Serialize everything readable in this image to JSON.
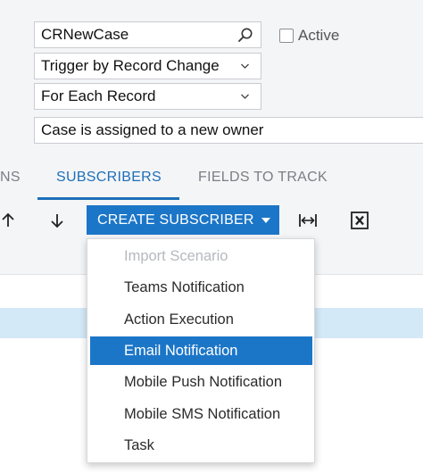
{
  "form": {
    "name_value": "CRNewCase",
    "trigger_value": "Trigger by Record Change",
    "each_value": "For Each Record",
    "description_value": "Case is assigned to a new owner",
    "active_label": "Active",
    "active_checked": false
  },
  "tabs": {
    "partial": "NS",
    "subscribers": "SUBSCRIBERS",
    "fields": "FIELDS TO TRACK"
  },
  "toolbar": {
    "create_label": "CREATE SUBSCRIBER"
  },
  "menu": {
    "items": [
      {
        "label": "Import Scenario",
        "state": "disabled"
      },
      {
        "label": "Teams Notification",
        "state": "normal"
      },
      {
        "label": "Action Execution",
        "state": "normal"
      },
      {
        "label": "Email Notification",
        "state": "selected"
      },
      {
        "label": "Mobile Push Notification",
        "state": "normal"
      },
      {
        "label": "Mobile SMS Notification",
        "state": "normal"
      },
      {
        "label": "Task",
        "state": "normal"
      }
    ]
  },
  "colors": {
    "accent": "#1c76c8",
    "tab_active": "#1d6fb8",
    "selected_row": "#d4e9f8"
  },
  "icons": [
    "search-icon",
    "chevron-down-icon",
    "arrow-up-icon",
    "arrow-down-icon",
    "caret-down-icon",
    "fit-width-icon",
    "excel-export-icon"
  ]
}
